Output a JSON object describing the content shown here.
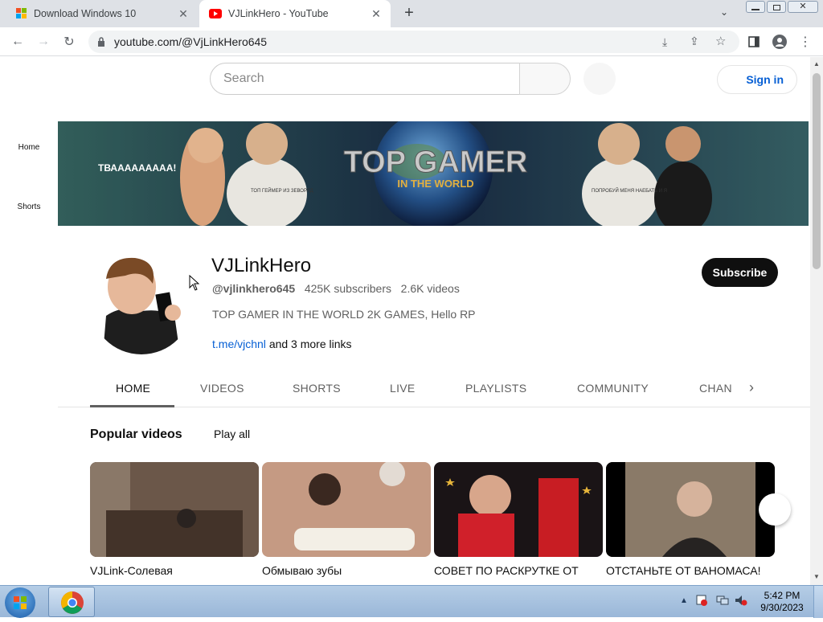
{
  "browser": {
    "tabs": [
      {
        "title": "Download Windows 10",
        "icon": "windows-logo-icon",
        "active": false
      },
      {
        "title": "VJLinkHero - YouTube",
        "icon": "youtube-icon",
        "active": true
      }
    ],
    "url": "youtube.com/@VjLinkHero645"
  },
  "youtube": {
    "search_placeholder": "Search",
    "sign_in": "Sign in",
    "nav": [
      {
        "label": "Home",
        "icon": "home-icon"
      },
      {
        "label": "Shorts",
        "icon": "shorts-icon"
      }
    ],
    "banner": {
      "logo_text": "TOP GAMER",
      "logo_sub": "IN THE WORLD",
      "left_shout": "ТВААААААААА!",
      "shirt_left": "ТОП ГЕЙМЕР ИЗ ЗЕВОРЛД",
      "shirt_right": "ПОПРОБУЙ МЕНЯ НАЕБАТЬ И Я"
    },
    "channel": {
      "name": "VJLinkHero",
      "handle": "@vjlinkhero645",
      "subscribers": "425K subscribers",
      "videos": "2.6K videos",
      "description": "TOP GAMER IN THE WORLD 2K GAMES, Hello RP",
      "link": "t.me/vjchnl",
      "more_links": "and 3 more links",
      "subscribe": "Subscribe"
    },
    "tabs": [
      "HOME",
      "VIDEOS",
      "SHORTS",
      "LIVE",
      "PLAYLISTS",
      "COMMUNITY",
      "CHANI"
    ],
    "section": {
      "title": "Popular videos",
      "play_all": "Play all",
      "videos": [
        {
          "title": "VJLink-Солевая"
        },
        {
          "title": "Обмываю зубы"
        },
        {
          "title": "СОВЕТ ПО РАСКРУТКЕ ОТ"
        },
        {
          "title": "ОТСТАНЬТЕ ОТ ВАНОМАСА!"
        }
      ]
    }
  },
  "taskbar": {
    "time": "5:42 PM",
    "date": "9/30/2023"
  }
}
